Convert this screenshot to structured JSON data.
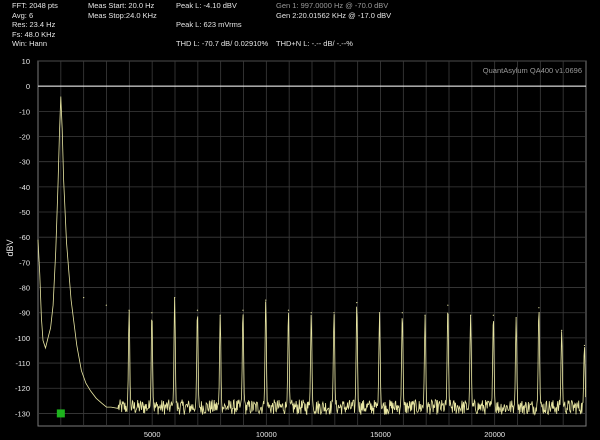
{
  "header": {
    "fft": "FFT: 2048 pts",
    "avg": "Avg: 6",
    "res": "Res: 23.4 Hz",
    "fs": "Fs: 48.0 KHz",
    "win": "Win: Hann",
    "meas_start": "Meas Start: 20.0 Hz",
    "meas_stop": "Meas Stop:24.0 KHz",
    "peak_l_db": "Peak L: -4.10 dBV",
    "peak_l_mv": "Peak L: 623 mVrms",
    "gen1": "Gen 1: 997.0000 Hz @ -70.0  dBV",
    "gen2": "Gen 2:20.01562 KHz @ -17.0  dBV",
    "thd": "THD L: -70.7 dB/ 0.02910%",
    "thdn": "THD+N L: -.-- dB/ -.--%"
  },
  "watermark": "QuantAsylum QA400 v1.0696",
  "colors": {
    "trace": "#e8e6a2",
    "grid": "#3c3c3c",
    "marker": "#1db31d",
    "text": "#e6e6e6",
    "dim_text": "#9a9a9a"
  },
  "chart_data": {
    "type": "line",
    "title": "",
    "xlabel": "",
    "ylabel": "dBV",
    "xlim": [
      0,
      24000
    ],
    "ylim": [
      -135,
      10
    ],
    "yticks": [
      10,
      0,
      -10,
      -20,
      -30,
      -40,
      -50,
      -60,
      -70,
      -80,
      -90,
      -100,
      -110,
      -120,
      -130
    ],
    "xticks": [
      5000,
      10000,
      15000,
      20000
    ],
    "grid": true,
    "reference_line_db": 0,
    "series": [
      {
        "x": [
          0,
          80,
          150,
          220,
          330,
          440,
          550,
          660,
          780,
          880,
          940,
          997,
          1060,
          1120,
          1250,
          1450,
          1700,
          1900,
          2100,
          2300,
          2550,
          2800,
          3000,
          3200,
          3500
        ],
        "y": [
          -61,
          -75,
          -92,
          -101,
          -104,
          -100,
          -96,
          -87,
          -65,
          -38,
          -18,
          -4.1,
          -17,
          -37,
          -62,
          -85,
          -103,
          -113,
          -118,
          -121,
          -124,
          -126,
          -127.5,
          -127.5,
          -128
        ]
      }
    ],
    "harmonic_peaks": {
      "x": [
        2000,
        2993,
        3990,
        4988,
        5985,
        6982,
        7979,
        8976,
        9973,
        10970,
        11967,
        12964,
        13961,
        14958,
        15955,
        16952,
        17949,
        18946,
        19943,
        20940,
        21937,
        22934,
        23931
      ],
      "y": [
        -84,
        -87,
        -89,
        -90,
        -84,
        -89,
        -91,
        -89,
        -85,
        -89,
        -90,
        -90,
        -86,
        -90,
        -90,
        -91,
        -87,
        -91,
        -91,
        -92,
        -88,
        -97,
        -103
      ]
    },
    "noise_floor_db": -127.5,
    "marker": {
      "x": 1000,
      "y": -130
    }
  }
}
